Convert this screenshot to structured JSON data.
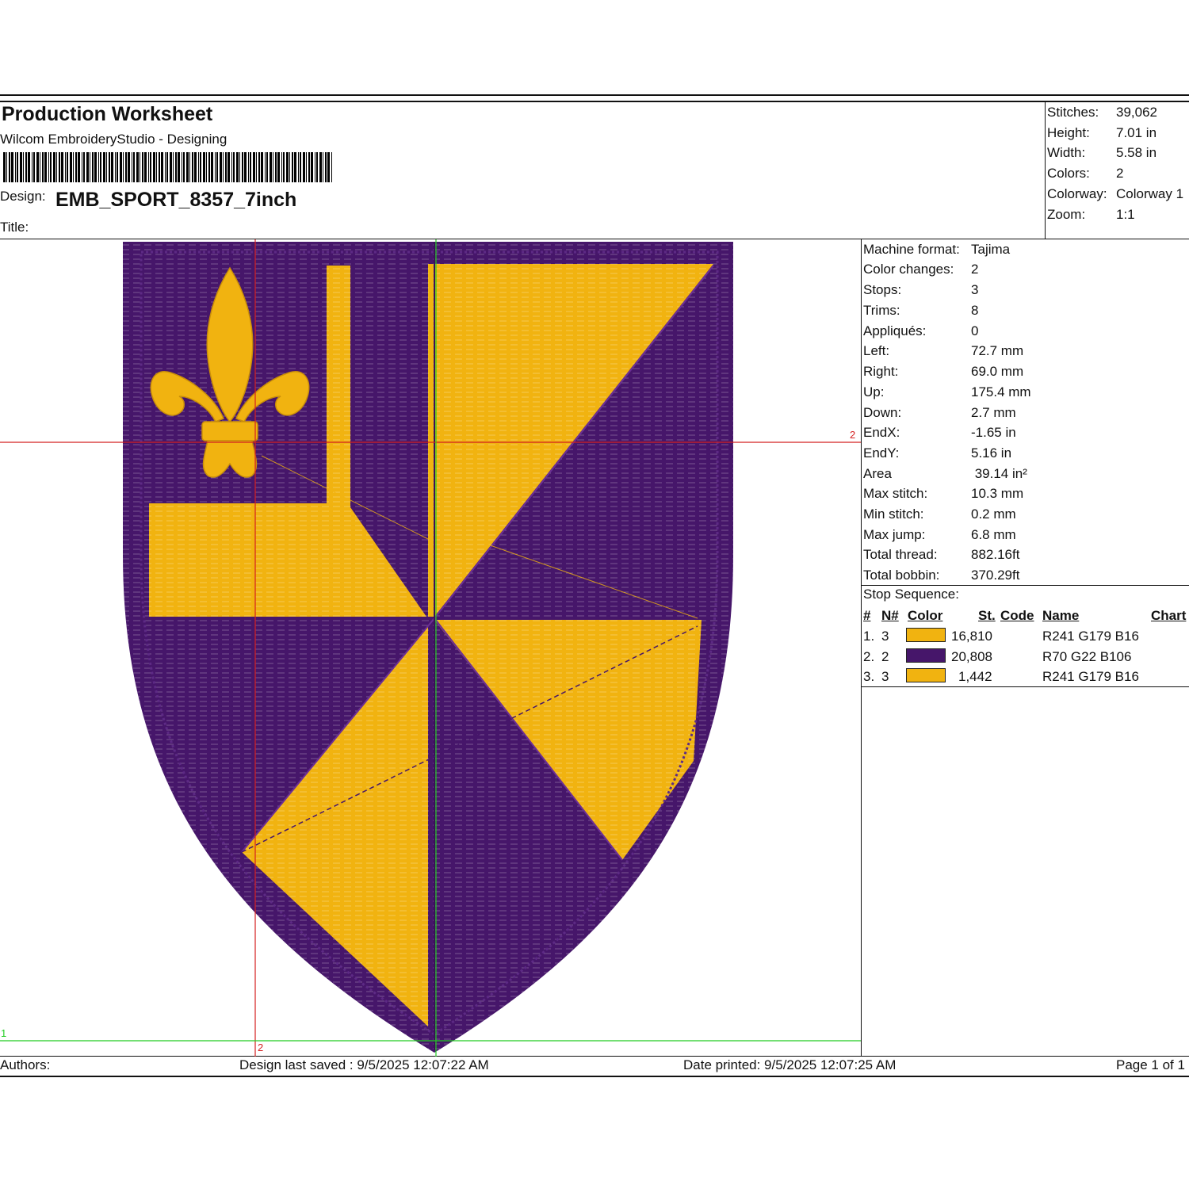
{
  "header": {
    "title": "Production Worksheet",
    "subtitle": "Wilcom EmbroideryStudio - Designing",
    "design_label": "Design:",
    "design_name": "EMB_SPORT_8357_7inch",
    "title_label": "Title:"
  },
  "summary": [
    {
      "label": "Stitches:",
      "value": "39,062"
    },
    {
      "label": "Height:",
      "value": "7.01 in"
    },
    {
      "label": "Width:",
      "value": "5.58 in"
    },
    {
      "label": "Colors:",
      "value": "2"
    },
    {
      "label": "Colorway:",
      "value": "Colorway 1"
    },
    {
      "label": "Zoom:",
      "value": "1:1"
    }
  ],
  "machine": [
    {
      "label": "Machine format:",
      "value": "Tajima"
    },
    {
      "label": "Color changes:",
      "value": "2"
    },
    {
      "label": "Stops:",
      "value": "3"
    },
    {
      "label": "Trims:",
      "value": "8"
    },
    {
      "label": "Appliqués:",
      "value": "0"
    },
    {
      "label": "Left:",
      "value": "72.7 mm"
    },
    {
      "label": "Right:",
      "value": "69.0 mm"
    },
    {
      "label": "Up:",
      "value": "175.4 mm"
    },
    {
      "label": "Down:",
      "value": "2.7 mm"
    },
    {
      "label": "EndX:",
      "value": "-1.65 in"
    },
    {
      "label": "EndY:",
      "value": "5.16 in"
    },
    {
      "label": "Area",
      "value": " 39.14 in²"
    },
    {
      "label": "Max stitch:",
      "value": "10.3 mm"
    },
    {
      "label": "Min stitch:",
      "value": "0.2 mm"
    },
    {
      "label": "Max jump:",
      "value": "6.8 mm"
    },
    {
      "label": "Total thread:",
      "value": "882.16ft"
    },
    {
      "label": "Total bobbin:",
      "value": "370.29ft"
    }
  ],
  "stop_sequence": {
    "title": "Stop Sequence:",
    "columns": {
      "num": "#",
      "n": "N#",
      "color": "Color",
      "st": "St.",
      "code": "Code",
      "name": "Name",
      "chart": "Chart"
    },
    "rows": [
      {
        "num": "1.",
        "n": "3",
        "color": "#f1b310",
        "st": "16,810",
        "code": "",
        "name": "R241 G179 B16",
        "chart": ""
      },
      {
        "num": "2.",
        "n": "2",
        "color": "#46166a",
        "st": "20,808",
        "code": "",
        "name": "R70 G22 B106",
        "chart": ""
      },
      {
        "num": "3.",
        "n": "3",
        "color": "#f1b310",
        "st": "1,442",
        "code": "",
        "name": "R241 G179 B16",
        "chart": ""
      }
    ]
  },
  "guides": {
    "horizontal_red": "2",
    "vertical_red": "2",
    "horizontal_green": "1"
  },
  "footer": {
    "authors": "Authors:",
    "saved": "Design last saved : 9/5/2025 12:07:22 AM",
    "printed": "Date printed: 9/5/2025 12:07:25 AM",
    "page": "Page 1 of 1"
  },
  "colors": {
    "gold": "#f1b310",
    "purple": "#46166a",
    "red_guide": "#d42020",
    "green_guide": "#22cc22"
  }
}
